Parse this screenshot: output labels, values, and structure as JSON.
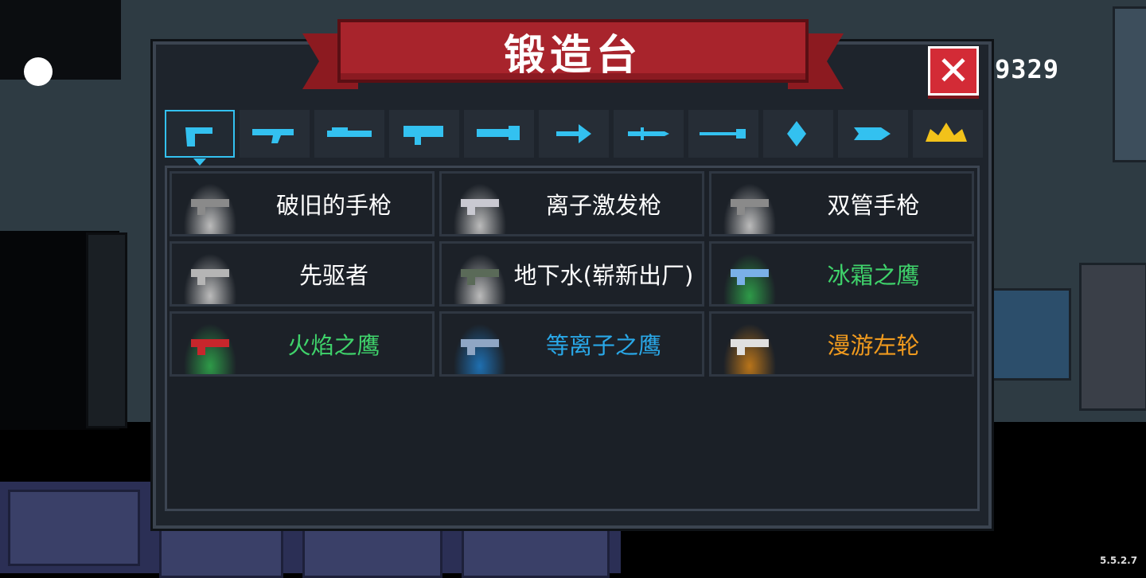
{
  "title": "锻造台",
  "close_label": "✕",
  "score": "9329",
  "version": "5.5.2.7",
  "accent_color": "#33c1f0",
  "tabs": [
    {
      "icon": "pistol-icon",
      "active": true
    },
    {
      "icon": "rifle-icon",
      "active": false
    },
    {
      "icon": "shotgun-icon",
      "active": false
    },
    {
      "icon": "launcher-icon",
      "active": false
    },
    {
      "icon": "laser-gun-icon",
      "active": false
    },
    {
      "icon": "bow-icon",
      "active": false
    },
    {
      "icon": "sword-icon",
      "active": false
    },
    {
      "icon": "spear-icon",
      "active": false
    },
    {
      "icon": "staff-icon",
      "active": false
    },
    {
      "icon": "fish-icon",
      "active": false
    },
    {
      "icon": "crown-icon",
      "active": false
    }
  ],
  "weapons": [
    {
      "name": "破旧的手枪",
      "rarity_color": "#ffffff",
      "glow": "#bbbbbb",
      "icon": "old-pistol-icon",
      "icon_color": "#8a8a8a"
    },
    {
      "name": "离子激发枪",
      "rarity_color": "#ffffff",
      "glow": "#bbbbbb",
      "icon": "ion-blaster-icon",
      "icon_color": "#c9c9d1"
    },
    {
      "name": "双管手枪",
      "rarity_color": "#ffffff",
      "glow": "#bbbbbb",
      "icon": "double-barrel-pistol-icon",
      "icon_color": "#8a8a8a"
    },
    {
      "name": "先驱者",
      "rarity_color": "#ffffff",
      "glow": "#bbbbbb",
      "icon": "pioneer-icon",
      "icon_color": "#b5b5b5"
    },
    {
      "name": "地下水(崭新出厂)",
      "rarity_color": "#ffffff",
      "glow": "#bbbbbb",
      "icon": "smg-icon",
      "icon_color": "#5a6a58"
    },
    {
      "name": "冰霜之鹰",
      "rarity_color": "#3fd36b",
      "glow": "#2e9a48",
      "icon": "frost-eagle-icon",
      "icon_color": "#7ab0e8"
    },
    {
      "name": "火焰之鹰",
      "rarity_color": "#3fd36b",
      "glow": "#2e9a48",
      "icon": "fire-eagle-icon",
      "icon_color": "#c8262c"
    },
    {
      "name": "等离子之鹰",
      "rarity_color": "#29a8e8",
      "glow": "#1f6fb0",
      "icon": "plasma-eagle-icon",
      "icon_color": "#8fa6c4"
    },
    {
      "name": "漫游左轮",
      "rarity_color": "#f09a1e",
      "glow": "#b8741a",
      "icon": "revolver-icon",
      "icon_color": "#e0e0e0"
    }
  ]
}
